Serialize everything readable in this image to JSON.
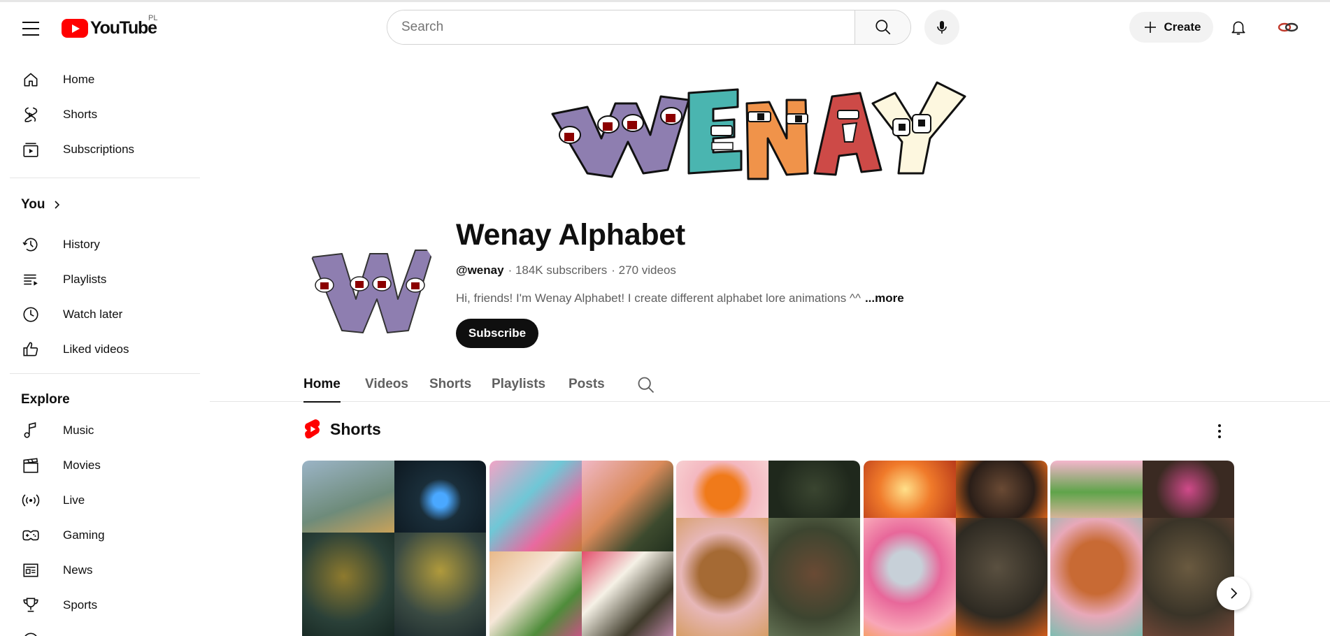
{
  "header": {
    "logo_text": "YouTube",
    "region": "PL",
    "search_placeholder": "Search",
    "create_label": "Create"
  },
  "sidebar": {
    "main": [
      {
        "label": "Home",
        "icon": "home-icon"
      },
      {
        "label": "Shorts",
        "icon": "shorts-icon"
      },
      {
        "label": "Subscriptions",
        "icon": "subscriptions-icon"
      }
    ],
    "you_heading": "You",
    "you": [
      {
        "label": "History",
        "icon": "history-icon"
      },
      {
        "label": "Playlists",
        "icon": "playlists-icon"
      },
      {
        "label": "Watch later",
        "icon": "watch-later-icon"
      },
      {
        "label": "Liked videos",
        "icon": "liked-videos-icon"
      }
    ],
    "explore_heading": "Explore",
    "explore": [
      {
        "label": "Music",
        "icon": "music-icon"
      },
      {
        "label": "Movies",
        "icon": "movies-icon"
      },
      {
        "label": "Live",
        "icon": "live-icon"
      },
      {
        "label": "Gaming",
        "icon": "gaming-icon"
      },
      {
        "label": "News",
        "icon": "news-icon"
      },
      {
        "label": "Sports",
        "icon": "sports-icon"
      }
    ]
  },
  "channel": {
    "banner_text": "WENAY",
    "name": "Wenay Alphabet",
    "handle": "@wenay",
    "subscribers": "· 184K subscribers",
    "videos": "· 270 videos",
    "description": "Hi, friends! I'm Wenay Alphabet! I create different alphabet lore animations ^^",
    "more_label": "...more",
    "subscribe_label": "Subscribe"
  },
  "tabs": [
    {
      "label": "Home",
      "active": true
    },
    {
      "label": "Videos",
      "active": false
    },
    {
      "label": "Shorts",
      "active": false
    },
    {
      "label": "Playlists",
      "active": false
    },
    {
      "label": "Posts",
      "active": false
    }
  ],
  "shelf": {
    "title": "Shorts"
  },
  "colors": {
    "brand_red": "#ff0000",
    "text_primary": "#0f0f0f",
    "text_secondary": "#606060",
    "chip_bg": "#f2f2f2"
  }
}
